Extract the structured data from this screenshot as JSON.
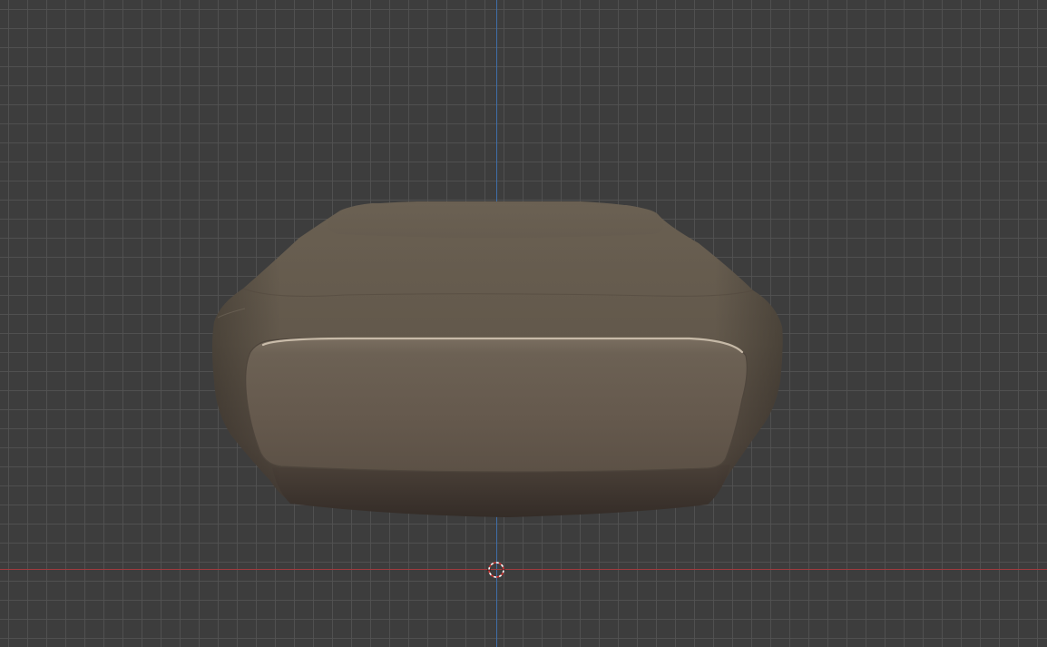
{
  "viewport": {
    "view": "front-orthographic",
    "grid": true,
    "colors": {
      "background": "#3d3d3d",
      "grid_line": "#525252",
      "axis_x": "#a03a3e",
      "axis_z": "#3f6ea8",
      "mesh_base": "#5e5448",
      "mesh_highlight": "#c9bba8",
      "mesh_shadow": "#3f3630"
    },
    "objects": [
      {
        "name": "sculpted-mesh",
        "shading": "solid",
        "selected": false
      }
    ],
    "cursor": {
      "icon": "3d-cursor-icon"
    }
  }
}
